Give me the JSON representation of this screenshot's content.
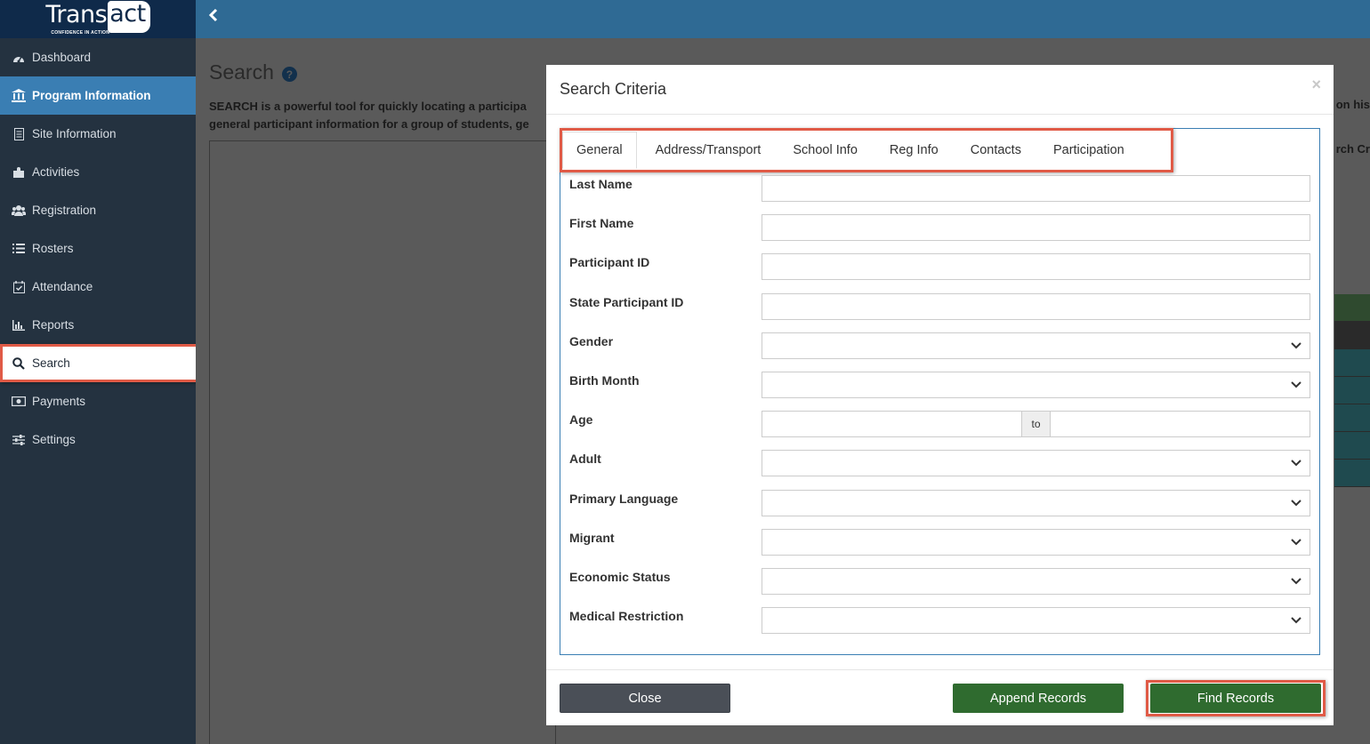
{
  "app": {
    "logo_text_main": "Trans",
    "logo_text_box": "act",
    "logo_tagline": "CONFIDENCE IN ACTION"
  },
  "sidebar": {
    "items": [
      {
        "label": "Dashboard",
        "icon": "dashboard-icon"
      },
      {
        "label": "Program Information",
        "icon": "building-icon",
        "active": true
      },
      {
        "label": "Site Information",
        "icon": "document-icon"
      },
      {
        "label": "Activities",
        "icon": "puzzle-icon"
      },
      {
        "label": "Registration",
        "icon": "users-icon"
      },
      {
        "label": "Rosters",
        "icon": "list-icon"
      },
      {
        "label": "Attendance",
        "icon": "calendar-check-icon"
      },
      {
        "label": "Reports",
        "icon": "bar-chart-icon"
      },
      {
        "label": "Search",
        "icon": "search-icon",
        "highlighted": true
      },
      {
        "label": "Payments",
        "icon": "money-icon"
      },
      {
        "label": "Settings",
        "icon": "sliders-icon"
      }
    ]
  },
  "page": {
    "title": "Search",
    "description_line1": "SEARCH is a powerful tool for quickly locating a participa",
    "description_line2": "general participant information for a group of students, ge",
    "description_right": "on his",
    "right_text": "rch Cr"
  },
  "modal": {
    "title": "Search Criteria",
    "close_symbol": "×",
    "tabs": [
      "General",
      "Address/Transport",
      "School Info",
      "Reg Info",
      "Contacts",
      "Participation"
    ],
    "active_tab": "General",
    "fields": {
      "last_name": "Last Name",
      "first_name": "First Name",
      "participant_id": "Participant ID",
      "state_participant_id": "State Participant ID",
      "gender": "Gender",
      "birth_month": "Birth Month",
      "age": "Age",
      "age_to": "to",
      "adult": "Adult",
      "primary_language": "Primary Language",
      "migrant": "Migrant",
      "economic_status": "Economic Status",
      "medical_restriction": "Medical Restriction"
    },
    "buttons": {
      "close": "Close",
      "append": "Append Records",
      "find": "Find Records"
    }
  },
  "colors": {
    "sidebar_bg": "#243240",
    "active_nav": "#3a7eb3",
    "highlight": "#e05a46",
    "primary_button": "#2f6b2f",
    "secondary_button": "#4a4f57"
  }
}
